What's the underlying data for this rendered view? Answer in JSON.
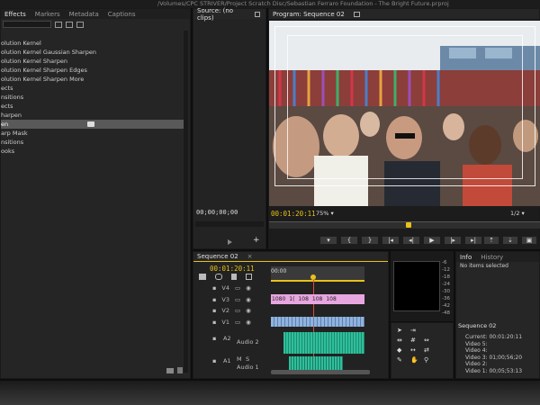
{
  "window": {
    "path": "/Volumes/CPC STRIVER/Project Scratch Disc/Sebastian Ferraro Foundation - The Bright Future.prproj"
  },
  "effects_panel": {
    "tabs": [
      "Effects",
      "Markers",
      "Metadata",
      "Captions"
    ],
    "items": [
      "olution Kernel",
      "olution Kernel Gaussian Sharpen",
      "olution Kernel Sharpen",
      "olution Kernel Sharpen Edges",
      "olution Kernel Sharpen More",
      "ects",
      "nsitions",
      "ects",
      "harpen",
      "en",
      "arp Mask",
      "nsitions",
      "ooks"
    ],
    "selected_index": 9
  },
  "source_monitor": {
    "tab": "Source: (no clips)",
    "timecode": "00;00;00;00"
  },
  "program_monitor": {
    "tab": "Program: Sequence 02",
    "timecode": "00:01:20:11",
    "zoom": "75%",
    "resolution": "1/2"
  },
  "timeline": {
    "tab": "Sequence 02",
    "timecode": "00:01:20:11",
    "ruler_start": "00:00",
    "tracks": [
      {
        "name": "V4"
      },
      {
        "name": "V3"
      },
      {
        "name": "V2"
      },
      {
        "name": "V1"
      },
      {
        "name": "A2",
        "label": "Audio 2"
      },
      {
        "name": "A1",
        "label": "Audio 1"
      }
    ],
    "v3_clip_labels": [
      "1080",
      "1(",
      "108",
      "108",
      "108"
    ]
  },
  "audio_meter": {
    "ticks": [
      "-6",
      "-12",
      "-18",
      "-24",
      "-30",
      "-36",
      "-42",
      "-48"
    ]
  },
  "info_panel": {
    "tabs": [
      "Info",
      "History"
    ],
    "no_items": "No items selected",
    "sequence": "Sequence 02",
    "lines": [
      "Current: 00:01:20:11",
      "Video 5:",
      "Video 4:",
      "Video 3: 01;00;56;20",
      "Video 2:",
      "Video 1: 00;05;53:13"
    ]
  },
  "colors": {
    "accent_yellow": "#e8c11a",
    "clip_pink": "#e7a6e0",
    "clip_blue": "#8fb3e0",
    "clip_green": "#2fbf9b"
  }
}
